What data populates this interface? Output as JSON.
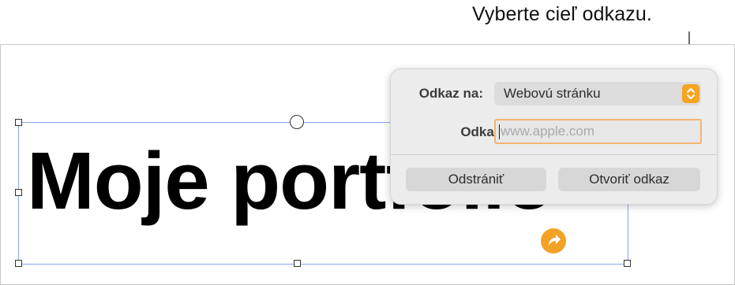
{
  "callout": {
    "text": "Vyberte cieľ odkazu."
  },
  "document": {
    "title_text": "Moje portfolio"
  },
  "popover": {
    "link_to_label": "Odkaz na:",
    "link_to_value": "Webovú stránku",
    "link_label": "Odkaz:",
    "link_placeholder": "www.apple.com",
    "link_value": "",
    "remove_button": "Odstrániť",
    "open_link_button": "Otvoriť odkaz"
  },
  "colors": {
    "accent": "#f5a423",
    "selection": "#8aa4f5",
    "link_badge": "#f2a224"
  },
  "icons": {
    "stepper": "up-down-chevron-icon",
    "link_badge": "link-arrow-icon",
    "rotate_handle": "rotate-handle-icon"
  }
}
